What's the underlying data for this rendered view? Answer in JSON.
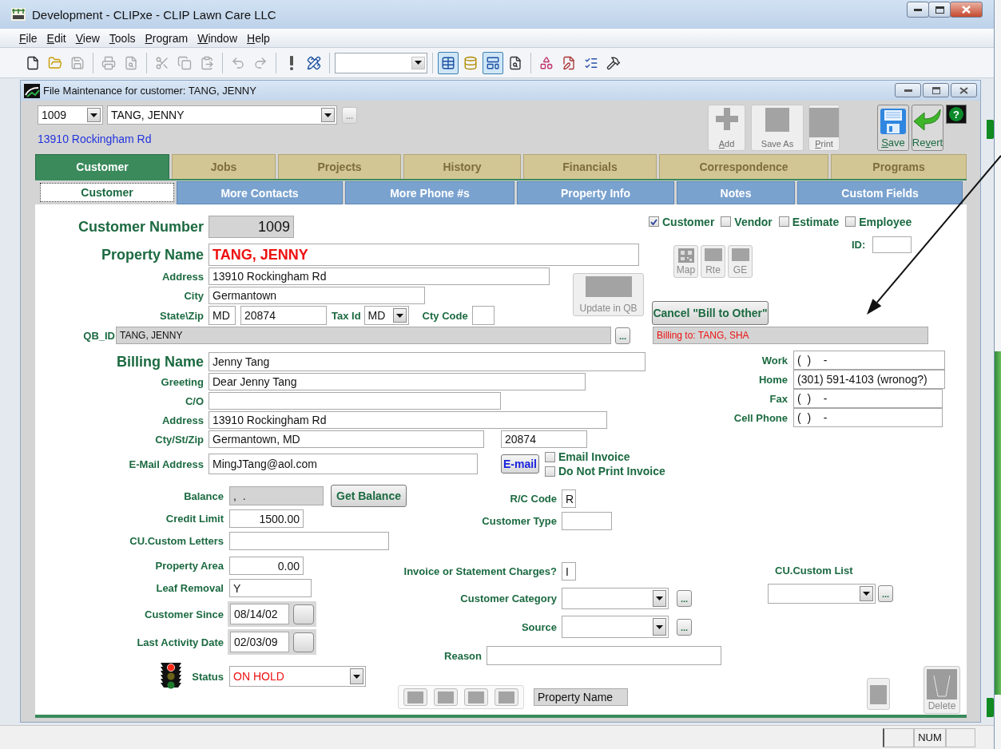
{
  "window": {
    "title": "Development - CLIPxe - CLIP Lawn Care LLC"
  },
  "menu": [
    {
      "key": "F",
      "rest": "ile"
    },
    {
      "key": "E",
      "rest": "dit"
    },
    {
      "key": "V",
      "rest": "iew"
    },
    {
      "key": "T",
      "rest": "ools"
    },
    {
      "key": "P",
      "rest": "rogram"
    },
    {
      "key": "W",
      "rest": "indow"
    },
    {
      "key": "H",
      "rest": "elp"
    }
  ],
  "toolbar": [
    {
      "kind": "new",
      "disabled": false
    },
    {
      "kind": "open",
      "disabled": false
    },
    {
      "kind": "save",
      "disabled": true
    },
    {
      "kind": "separator"
    },
    {
      "kind": "print",
      "disabled": true
    },
    {
      "kind": "preview",
      "disabled": true
    },
    {
      "kind": "separator"
    },
    {
      "kind": "cut",
      "disabled": true
    },
    {
      "kind": "copy",
      "disabled": true
    },
    {
      "kind": "paste",
      "disabled": true
    },
    {
      "kind": "separator"
    },
    {
      "kind": "undo",
      "disabled": true
    },
    {
      "kind": "redo",
      "disabled": true
    },
    {
      "kind": "separator"
    },
    {
      "kind": "alert",
      "disabled": false
    },
    {
      "kind": "design",
      "disabled": false
    },
    {
      "kind": "separator"
    },
    {
      "kind": "combo",
      "disabled": true
    },
    {
      "kind": "separator"
    },
    {
      "kind": "grid",
      "pressed": true
    },
    {
      "kind": "database",
      "pressed": false
    },
    {
      "kind": "form",
      "pressed": true
    },
    {
      "kind": "find",
      "pressed": false
    },
    {
      "kind": "separator"
    },
    {
      "kind": "shapes",
      "disabled": false
    },
    {
      "kind": "edit",
      "disabled": false
    },
    {
      "kind": "checklist",
      "disabled": false
    },
    {
      "kind": "tools",
      "disabled": false
    }
  ],
  "child_window": {
    "title": "File Maintenance for customer: TANG, JENNY"
  },
  "record_picker": {
    "number": "1009",
    "name": "TANG, JENNY",
    "browse": "...",
    "address": "13910 Rockingham Rd"
  },
  "actions": [
    {
      "kind": "add",
      "key": "A",
      "post": "dd",
      "disabled": true
    },
    {
      "kind": "save_as",
      "pre": "Save As",
      "disabled": true
    },
    {
      "kind": "print",
      "key": "P",
      "post": "rint",
      "disabled": true
    },
    {
      "kind": "save",
      "key": "S",
      "post": "ave",
      "disabled": false
    },
    {
      "kind": "revert",
      "pre": "Re",
      "key": "v",
      "post": "ert",
      "disabled": false
    }
  ],
  "help_button": "?",
  "tabs": [
    {
      "label": "Customer",
      "selected": true,
      "disabled": false
    },
    {
      "label": "Jobs",
      "selected": false,
      "disabled": true
    },
    {
      "label": "Projects",
      "selected": false,
      "disabled": true
    },
    {
      "label": "History",
      "selected": false,
      "disabled": true
    },
    {
      "label": "Financials",
      "selected": false,
      "disabled": true
    },
    {
      "label": "Correspondence",
      "selected": false,
      "disabled": true
    },
    {
      "label": "Programs",
      "selected": false,
      "disabled": true
    }
  ],
  "subtabs": [
    {
      "label": "Customer",
      "selected": true
    },
    {
      "label": "More Contacts",
      "selected": false
    },
    {
      "label": "More Phone #s",
      "selected": false
    },
    {
      "label": "Property Info",
      "selected": false
    },
    {
      "label": "Notes",
      "selected": false
    },
    {
      "label": "Custom Fields",
      "selected": false
    }
  ],
  "form": {
    "customer_number": {
      "label": "Customer Number",
      "value": "1009"
    },
    "property_name": {
      "label": "Property Name",
      "value": "TANG, JENNY"
    },
    "address": {
      "label": "Address",
      "value": "13910 Rockingham Rd"
    },
    "city": {
      "label": "City",
      "value": "Germantown"
    },
    "state_zip": {
      "label": "State\\Zip",
      "state": "MD",
      "zip": "20874"
    },
    "tax_id": {
      "label": "Tax Id",
      "value": "MD"
    },
    "cty_code": {
      "label": "Cty Code"
    },
    "update_qb": {
      "label": "Update in QB",
      "disabled": true
    },
    "roles": [
      {
        "label": "Customer",
        "checked": true
      },
      {
        "label": "Vendor",
        "checked": false
      },
      {
        "label": "Estimate",
        "checked": false
      },
      {
        "label": "Employee",
        "checked": false
      }
    ],
    "id_field": {
      "label": "ID:"
    },
    "lookup_buttons": [
      {
        "label": "Map",
        "kind": "map"
      },
      {
        "label": "Rte",
        "kind": "image"
      },
      {
        "label": "GE",
        "kind": "image"
      }
    ],
    "cancel_bill_button": "Cancel \"Bill to Other\"",
    "qb_id": {
      "label": "QB_ID",
      "value": "TANG, JENNY",
      "browse": "..."
    },
    "billing_to": "Billing to: TANG, SHA",
    "billing_name": {
      "label": "Billing Name",
      "value": "Jenny Tang"
    },
    "greeting": {
      "label": "Greeting",
      "value": "Dear Jenny Tang"
    },
    "care_of": {
      "label": "C/O"
    },
    "billing_address": {
      "label": "Address",
      "value": "13910 Rockingham Rd"
    },
    "cty_st_zip": {
      "label": "Cty/St/Zip",
      "value": "Germantown, MD",
      "zip": "20874"
    },
    "email": {
      "label": "E-Mail Address",
      "value": "MingJTang@aol.com",
      "button": "E-mail"
    },
    "invoice_options": [
      {
        "label": "Email Invoice",
        "checked": false
      },
      {
        "label": "Do Not Print Invoice",
        "checked": false
      }
    ],
    "phones": [
      {
        "label": "Work",
        "value": "(  )    -"
      },
      {
        "label": "Home",
        "value": "(301) 591-4103 (wronog?)"
      },
      {
        "label": "Fax",
        "value": "(  )    -"
      },
      {
        "label": "Cell Phone",
        "value": "(  )    -"
      }
    ],
    "balance": {
      "label": "Balance",
      "value": ",  .",
      "button": "Get Balance"
    },
    "credit_limit": {
      "label": "Credit Limit",
      "value": "1500.00"
    },
    "custom_letters": {
      "label": "CU.Custom Letters"
    },
    "property_area": {
      "label": "Property Area",
      "value": "0.00"
    },
    "leaf_removal": {
      "label": "Leaf Removal",
      "value": "Y"
    },
    "customer_since": {
      "label": "Customer Since",
      "value": "08/14/02"
    },
    "last_activity": {
      "label": "Last Activity Date",
      "value": "02/03/09"
    },
    "status": {
      "label": "Status",
      "value": "ON HOLD",
      "lights": [
        {
          "lit": true,
          "color": "#ff2a1a"
        },
        {
          "lit": false,
          "color": "#6b6418"
        },
        {
          "lit": false,
          "color": "#1f7a2e"
        }
      ]
    },
    "rc_code": {
      "label": "R/C Code",
      "value": "R"
    },
    "customer_type": {
      "label": "Customer Type"
    },
    "charges": {
      "label": "Invoice or Statement Charges?",
      "value": "I"
    },
    "category": {
      "label": "Customer Category",
      "browse": "..."
    },
    "source": {
      "label": "Source",
      "browse": "..."
    },
    "reason": {
      "label": "Reason"
    },
    "sort_field": "Property Name",
    "custom_list": {
      "label": "CU.Custom List",
      "browse": "..."
    },
    "delete_button": {
      "label": "Delete",
      "disabled": true
    }
  },
  "status_bar": {
    "indicator": "NUM"
  }
}
